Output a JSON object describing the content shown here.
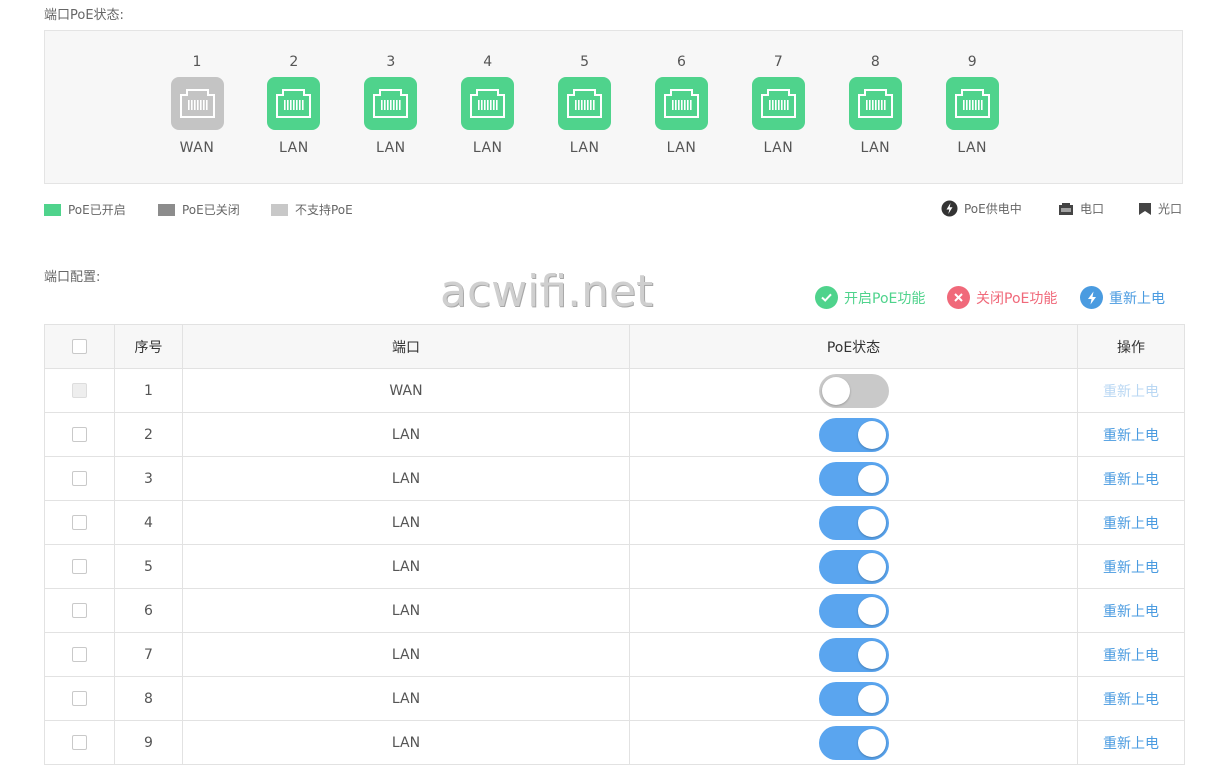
{
  "section_titles": {
    "poe_status": "端口PoE状态:",
    "port_config": "端口配置:"
  },
  "ports": [
    {
      "num": "1",
      "type": "WAN",
      "state": "unsupported",
      "color": "#c4c4c4"
    },
    {
      "num": "2",
      "type": "LAN",
      "state": "on",
      "color": "#4fd38c"
    },
    {
      "num": "3",
      "type": "LAN",
      "state": "on",
      "color": "#4fd38c"
    },
    {
      "num": "4",
      "type": "LAN",
      "state": "on",
      "color": "#4fd38c"
    },
    {
      "num": "5",
      "type": "LAN",
      "state": "on",
      "color": "#4fd38c"
    },
    {
      "num": "6",
      "type": "LAN",
      "state": "on",
      "color": "#4fd38c"
    },
    {
      "num": "7",
      "type": "LAN",
      "state": "on",
      "color": "#4fd38c"
    },
    {
      "num": "8",
      "type": "LAN",
      "state": "on",
      "color": "#4fd38c"
    },
    {
      "num": "9",
      "type": "LAN",
      "state": "on",
      "color": "#4fd38c"
    }
  ],
  "legend": {
    "poe_on": "PoE已开启",
    "poe_off": "PoE已关闭",
    "no_poe": "不支持PoE",
    "poe_supplying": "PoE供电中",
    "electric_port": "电口",
    "optical_port": "光口",
    "colors": {
      "on": "#4fd38c",
      "off": "#8c8c8c",
      "unsupported": "#c8c8c8"
    }
  },
  "watermark": "acwifi.net",
  "actions": {
    "enable": "开启PoE功能",
    "disable": "关闭PoE功能",
    "repower": "重新上电",
    "colors": {
      "enable": "#4fd38c",
      "disable": "#f0697a",
      "repower": "#4a9be0"
    }
  },
  "table": {
    "headers": {
      "index": "序号",
      "port": "端口",
      "poe_status": "PoE状态",
      "operation": "操作"
    },
    "rows": [
      {
        "index": "1",
        "port": "WAN",
        "poe_on": false,
        "op": "重新上电",
        "disabled": true
      },
      {
        "index": "2",
        "port": "LAN",
        "poe_on": true,
        "op": "重新上电",
        "disabled": false
      },
      {
        "index": "3",
        "port": "LAN",
        "poe_on": true,
        "op": "重新上电",
        "disabled": false
      },
      {
        "index": "4",
        "port": "LAN",
        "poe_on": true,
        "op": "重新上电",
        "disabled": false
      },
      {
        "index": "5",
        "port": "LAN",
        "poe_on": true,
        "op": "重新上电",
        "disabled": false
      },
      {
        "index": "6",
        "port": "LAN",
        "poe_on": true,
        "op": "重新上电",
        "disabled": false
      },
      {
        "index": "7",
        "port": "LAN",
        "poe_on": true,
        "op": "重新上电",
        "disabled": false
      },
      {
        "index": "8",
        "port": "LAN",
        "poe_on": true,
        "op": "重新上电",
        "disabled": false
      },
      {
        "index": "9",
        "port": "LAN",
        "poe_on": true,
        "op": "重新上电",
        "disabled": false
      }
    ]
  }
}
